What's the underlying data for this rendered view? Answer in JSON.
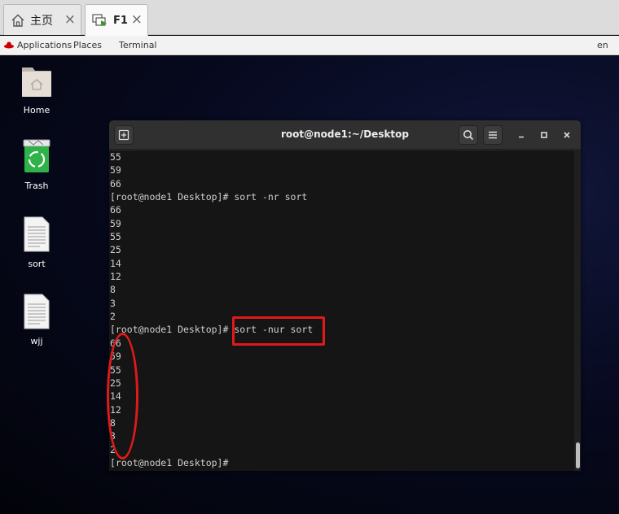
{
  "browser_tabs": [
    {
      "label": "主页",
      "icon": "home-icon"
    },
    {
      "label": "F1",
      "icon": "vm-console-icon"
    }
  ],
  "topbar": {
    "applications": "Applications",
    "places": "Places",
    "terminal": "Terminal",
    "language": "en"
  },
  "desktop_icons": [
    {
      "label": "Home",
      "icon": "home-folder-icon"
    },
    {
      "label": "Trash",
      "icon": "trash-icon"
    },
    {
      "label": "sort",
      "icon": "text-file-icon"
    },
    {
      "label": "wjj",
      "icon": "text-file-icon"
    }
  ],
  "terminal": {
    "title": "root@node1:~/Desktop",
    "lines": [
      "55",
      "59",
      "66",
      "[root@node1 Desktop]# sort -nr sort",
      "66",
      "59",
      "55",
      "25",
      "14",
      "12",
      "8",
      "3",
      "2",
      "[root@node1 Desktop]# sort -nur sort",
      "66",
      "59",
      "55",
      "25",
      "14",
      "12",
      "8",
      "3",
      "2",
      "[root@node1 Desktop]# "
    ]
  },
  "colors": {
    "annotation": "#e0191b",
    "terminal_bg": "#151515",
    "header_bg": "#303030"
  }
}
